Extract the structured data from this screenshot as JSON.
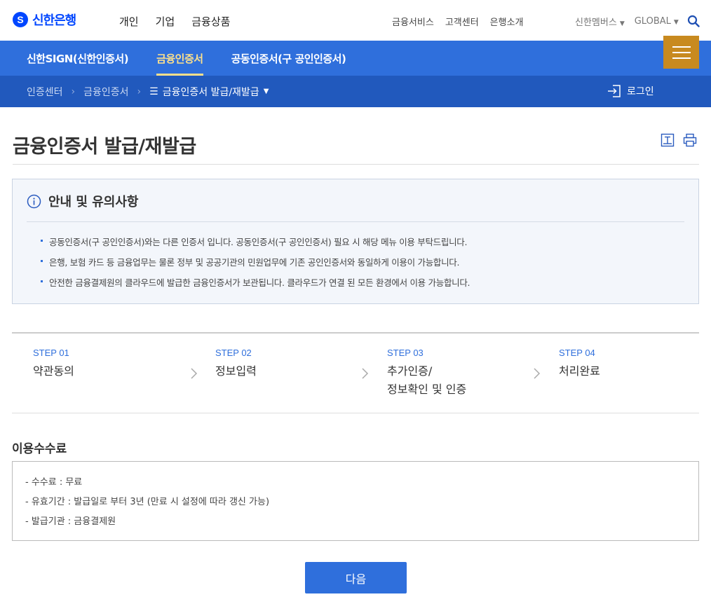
{
  "header": {
    "logo_text": "신한은행",
    "logo_mark": "S",
    "main_nav": [
      "개인",
      "기업",
      "금융상품"
    ],
    "sub_nav": [
      "금융서비스",
      "고객센터",
      "은행소개"
    ],
    "members_label": "신한멤버스",
    "global_label": "GLOBAL"
  },
  "tabs": [
    {
      "label": "신한SIGN(신한인증서)",
      "active": false
    },
    {
      "label": "금융인증서",
      "active": true
    },
    {
      "label": "공동인증서(구 공인인증서)",
      "active": false
    }
  ],
  "breadcrumb": {
    "items": [
      "인증센터",
      "금융인증서"
    ],
    "current": "금융인증서 발급/재발급",
    "login_label": "로그인"
  },
  "page": {
    "title": "금융인증서 발급/재발급"
  },
  "notice": {
    "title": "안내 및 유의사항",
    "items": [
      "공동인증서(구 공인인증서)와는 다른 인증서 입니다. 공동인증서(구 공인인증서) 필요 시 해당 메뉴 이용 부탁드립니다.",
      "은행, 보험 카드 등 금융업무는 물론 정부 및 공공기관의 민원업무에 기존 공인인증서와 동일하게 이용이 가능합니다.",
      "안전한 금융결제원의 클라우드에 발급한 금융인증서가 보관됩니다. 클라우드가 연결 된 모든 환경에서 이용 가능합니다."
    ]
  },
  "steps": [
    {
      "no": "STEP 01",
      "line1": "약관동의",
      "line2": ""
    },
    {
      "no": "STEP 02",
      "line1": "정보입력",
      "line2": ""
    },
    {
      "no": "STEP 03",
      "line1": "추가인증/",
      "line2": "정보확인 및 인증"
    },
    {
      "no": "STEP 04",
      "line1": "처리완료",
      "line2": ""
    }
  ],
  "fees": {
    "title": "이용수수료",
    "items": [
      "- 수수료 : 무료",
      "- 유효기간 : 발급일로 부터 3년 (만료 시 설정에 따라 갱신 가능)",
      "- 발급기관 : 금융결제원"
    ]
  },
  "next_label": "다음",
  "colors": {
    "primary": "#2f6fdc",
    "breadcrumb_bg": "#2159bd",
    "menu_button": "#c88a1f",
    "active_tab": "#fbe08c"
  }
}
